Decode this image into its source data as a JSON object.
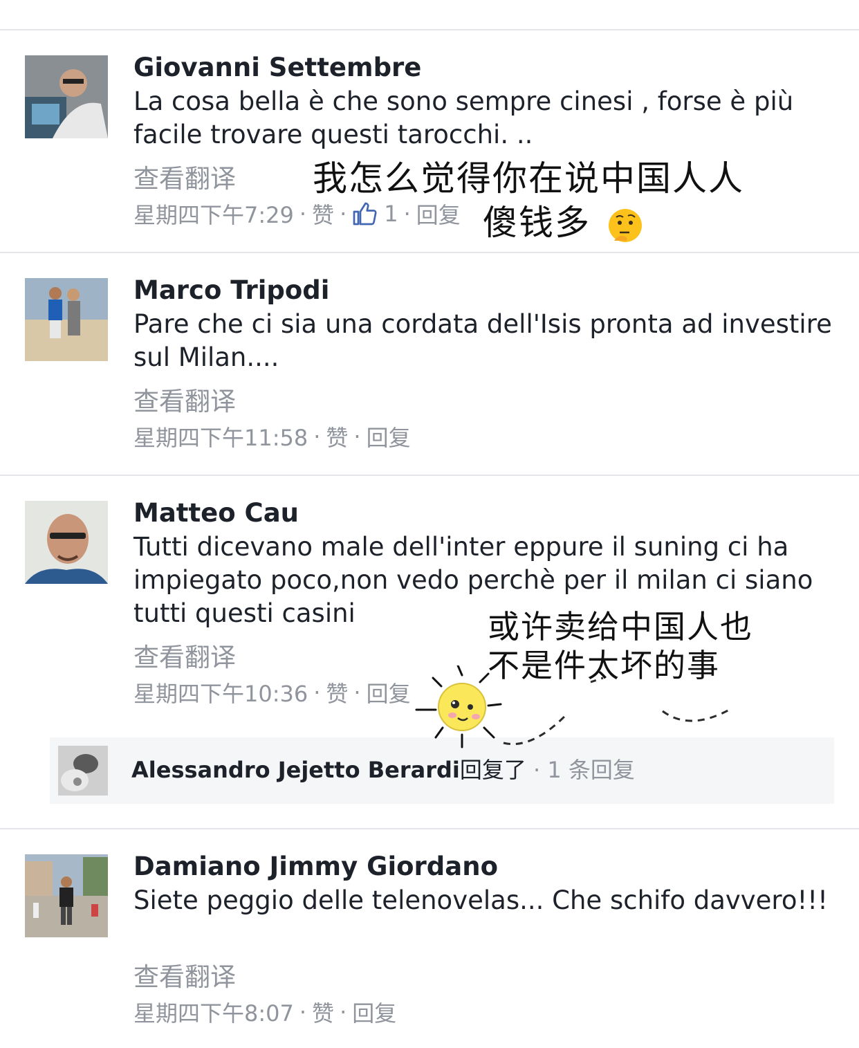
{
  "comments": [
    {
      "name": "Giovanni Settembre",
      "text": "La cosa bella è che sono sempre cinesi , forse è più facile trovare questi tarocchi. ..",
      "translate": "查看翻译",
      "time": "星期四下午7:29",
      "like": "赞",
      "like_count": "1",
      "reply": "回复"
    },
    {
      "name": "Marco Tripodi",
      "text": "Pare che ci sia una cordata dell'Isis pronta ad investire sul Milan....",
      "translate": "查看翻译",
      "time": "星期四下午11:58",
      "like": "赞",
      "reply": "回复"
    },
    {
      "name": "Matteo Cau",
      "text": "Tutti dicevano male dell'inter eppure il suning ci ha impiegato poco,non vedo perchè per il milan ci siano tutti questi casini",
      "translate": "查看翻译",
      "time": "星期四下午10:36",
      "like": "赞",
      "reply": "回复",
      "replies": {
        "name": "Alessandro Jejetto Berardi",
        "action": "回复了",
        "count": "1 条回复"
      }
    },
    {
      "name": "Damiano Jimmy Giordano",
      "text": "Siete peggio delle telenovelas... Che schifo davvero!!!",
      "translate": "查看翻译",
      "time": "星期四下午8:07",
      "like": "赞",
      "reply": "回复"
    }
  ],
  "annotations": {
    "first_line1": "我怎么觉得你在说中国人人",
    "first_line2": "傻钱多",
    "second_line1": "或许卖给中国人也",
    "second_line2": "不是件太坏的事"
  },
  "icons": {
    "like": "thumbs-up-icon",
    "thinking": "thinking-face-icon",
    "sun": "sun-doodle-icon"
  },
  "colors": {
    "text": "#1d2129",
    "meta": "#90949c",
    "like_blue": "#4267b2",
    "divider": "#e4e5e8",
    "reply_bg": "#f5f6f7"
  }
}
